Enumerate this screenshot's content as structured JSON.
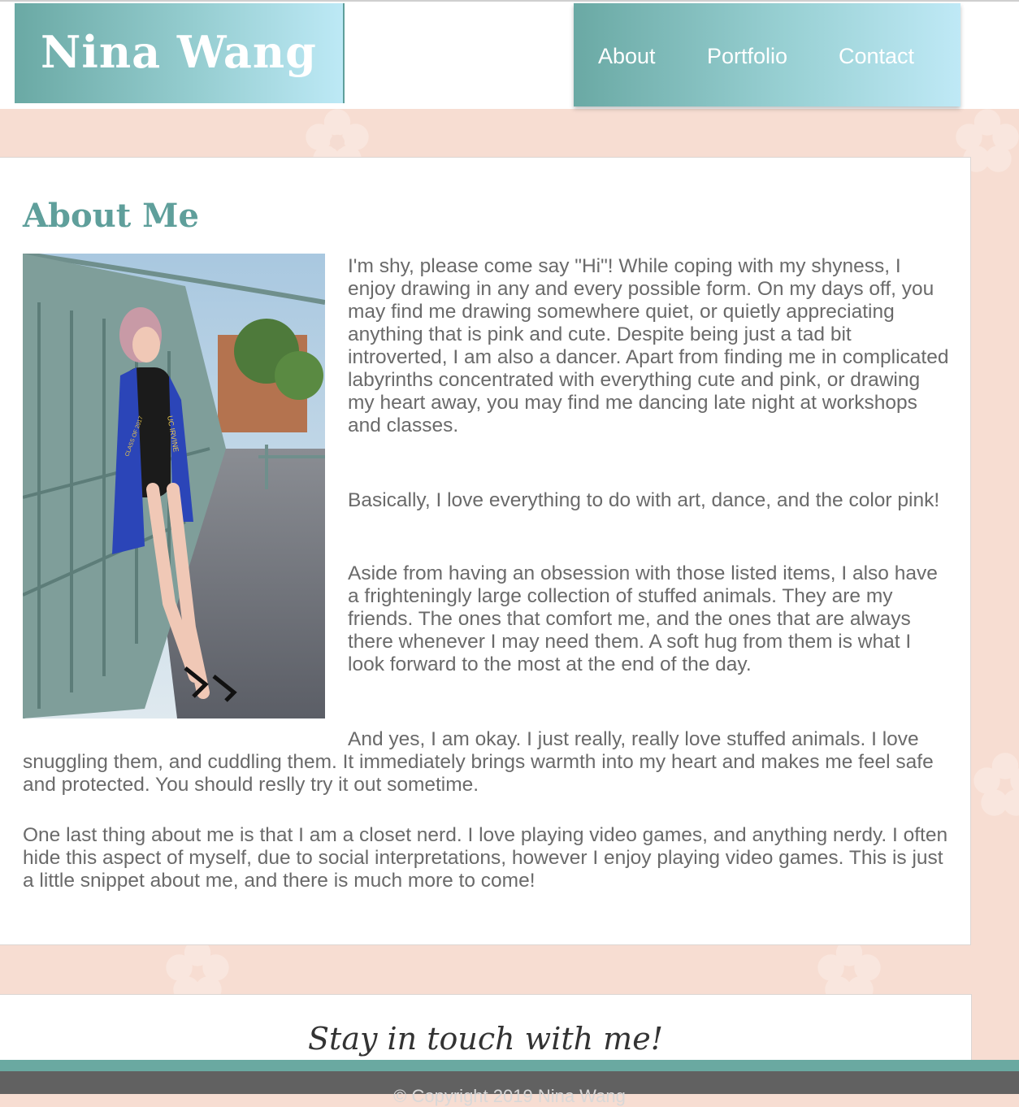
{
  "header": {
    "logo": "Nina Wang",
    "nav": [
      {
        "label": "About"
      },
      {
        "label": "Portfolio"
      },
      {
        "label": "Contact"
      }
    ]
  },
  "about": {
    "heading": "About Me",
    "paragraphs": [
      "I'm shy, please come say \"Hi\"! While coping with my shyness, I enjoy drawing in any and every possible form. On my days off, you may find me drawing somewhere quiet, or quietly appreciating anything that is pink and cute. Despite being just a tad bit introverted, I am also a dancer. Apart from finding me in complicated labyrinths concentrated with everything cute and pink, or drawing my heart away, you may find me dancing late night at workshops and classes.",
      "Basically, I love everything to do with art, dance, and the color pink!",
      "Aside from having an obsession with those listed items, I also have a frighteningly large collection of stuffed animals. They are my friends. The ones that comfort me, and the ones that are always there whenever I may need them. A soft hug from them is what I look forward to the most at the end of the day.",
      "And yes, I am okay. I just really, really love stuffed animals. I love snuggling them, and cuddling them. It immediately brings warmth into my heart and makes me feel safe and protected. You should reslly try it out sometime.",
      "One last thing about me is that I am a closet nerd. I love playing video games, and anything nerdy. I often hide this aspect of myself, due to social interpretations, however I enjoy playing video games. This is just a little snippet about me, and there is much more to come!"
    ],
    "photo_sash_text": "UC IRVINE",
    "photo_sash_class": "CLASS OF 2017"
  },
  "contact": {
    "tagline": "Stay in touch with me!"
  },
  "footer": {
    "copyright": "© Copyright 2019 Nina Wang"
  },
  "colors": {
    "teal": "#5f9f9b",
    "background_pink": "#f7ddd2",
    "text_gray": "#6a6a6a"
  }
}
